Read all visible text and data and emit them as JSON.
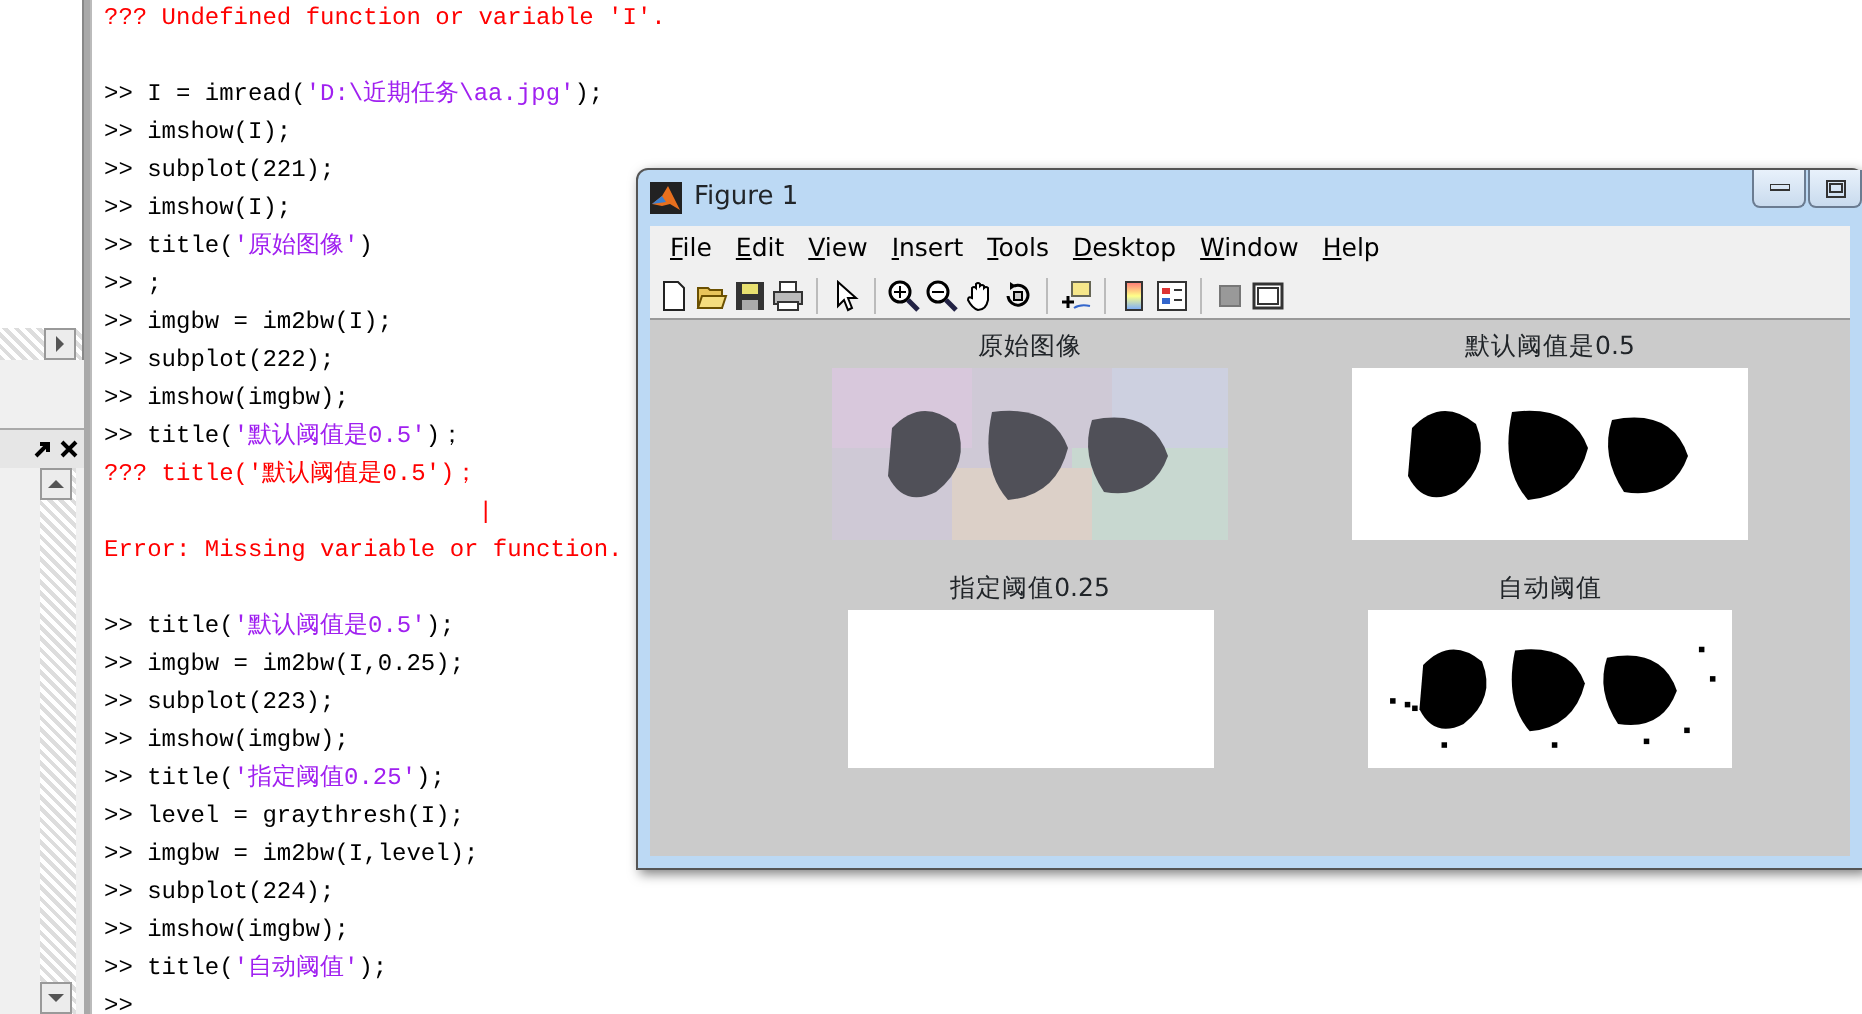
{
  "console": {
    "lines": [
      {
        "kind": "error",
        "text": "??? Undefined function or variable 'I'."
      },
      {
        "kind": "blank"
      },
      {
        "kind": "command",
        "segments": [
          {
            "kind": "code",
            "text": "I = imread("
          },
          {
            "kind": "string",
            "text": "'D:\\近期任务\\aa.jpg'"
          },
          {
            "kind": "code",
            "text": ");"
          }
        ]
      },
      {
        "kind": "command",
        "segments": [
          {
            "kind": "code",
            "text": "imshow(I);"
          }
        ]
      },
      {
        "kind": "command",
        "segments": [
          {
            "kind": "code",
            "text": "subplot(221);"
          }
        ]
      },
      {
        "kind": "command",
        "segments": [
          {
            "kind": "code",
            "text": "imshow(I);"
          }
        ]
      },
      {
        "kind": "command",
        "segments": [
          {
            "kind": "code",
            "text": "title("
          },
          {
            "kind": "string",
            "text": "'原始图像'"
          },
          {
            "kind": "code",
            "text": ")"
          }
        ]
      },
      {
        "kind": "command",
        "segments": [
          {
            "kind": "code",
            "text": ";"
          }
        ]
      },
      {
        "kind": "command",
        "segments": [
          {
            "kind": "code",
            "text": "imgbw = im2bw(I);"
          }
        ]
      },
      {
        "kind": "command",
        "segments": [
          {
            "kind": "code",
            "text": "subplot(222);"
          }
        ]
      },
      {
        "kind": "command",
        "segments": [
          {
            "kind": "code",
            "text": "imshow(imgbw);"
          }
        ]
      },
      {
        "kind": "command",
        "segments": [
          {
            "kind": "code",
            "text": "title("
          },
          {
            "kind": "string",
            "text": "'默认阈值是0.5'"
          },
          {
            "kind": "code",
            "text": ")；"
          }
        ]
      },
      {
        "kind": "error",
        "text": "??? title('默认阈值是0.5')；"
      },
      {
        "kind": "caret",
        "text": "|"
      },
      {
        "kind": "error",
        "text": "Error: Missing variable or function."
      },
      {
        "kind": "blank"
      },
      {
        "kind": "command",
        "segments": [
          {
            "kind": "code",
            "text": "title("
          },
          {
            "kind": "string",
            "text": "'默认阈值是0.5'"
          },
          {
            "kind": "code",
            "text": ");"
          }
        ]
      },
      {
        "kind": "command",
        "segments": [
          {
            "kind": "code",
            "text": "imgbw = im2bw(I,0.25);"
          }
        ]
      },
      {
        "kind": "command",
        "segments": [
          {
            "kind": "code",
            "text": "subplot(223);"
          }
        ]
      },
      {
        "kind": "command",
        "segments": [
          {
            "kind": "code",
            "text": "imshow(imgbw);"
          }
        ]
      },
      {
        "kind": "command",
        "segments": [
          {
            "kind": "code",
            "text": "title("
          },
          {
            "kind": "string",
            "text": "'指定阈值0.25'"
          },
          {
            "kind": "code",
            "text": ");"
          }
        ]
      },
      {
        "kind": "command",
        "segments": [
          {
            "kind": "code",
            "text": "level = graythresh(I);"
          }
        ]
      },
      {
        "kind": "command",
        "segments": [
          {
            "kind": "code",
            "text": "imgbw = im2bw(I,level);"
          }
        ]
      },
      {
        "kind": "command",
        "segments": [
          {
            "kind": "code",
            "text": "subplot(224);"
          }
        ]
      },
      {
        "kind": "command",
        "segments": [
          {
            "kind": "code",
            "text": "imshow(imgbw);"
          }
        ]
      },
      {
        "kind": "command",
        "segments": [
          {
            "kind": "code",
            "text": "title("
          },
          {
            "kind": "string",
            "text": "'自动阈值'"
          },
          {
            "kind": "code",
            "text": ");"
          }
        ]
      },
      {
        "kind": "command"
      }
    ],
    "prompt": ">>"
  },
  "figure": {
    "title": "Figure 1",
    "menus": [
      "File",
      "Edit",
      "View",
      "Insert",
      "Tools",
      "Desktop",
      "Window",
      "Help"
    ],
    "subplots": [
      {
        "title": "原始图像",
        "kind": "color"
      },
      {
        "title": "默认阈值是0.5",
        "kind": "binary"
      },
      {
        "title": "指定阈值0.25",
        "kind": "blank"
      },
      {
        "title": "自动阈值",
        "kind": "speckled"
      }
    ]
  }
}
